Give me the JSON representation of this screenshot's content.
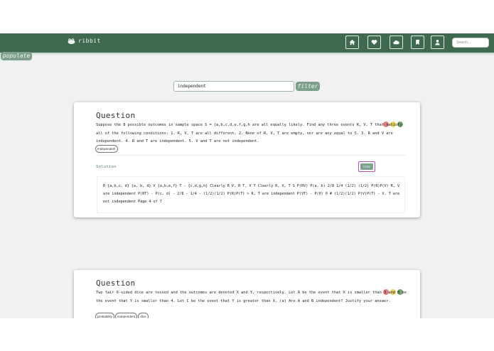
{
  "navbar": {
    "brand": "ribbit",
    "icons": [
      "home-icon",
      "heart-icon",
      "cloud-icon",
      "bookmark-icon",
      "user-icon"
    ],
    "search_placeholder": "Search...",
    "colors": {
      "bar": "#3f6a4f",
      "accent": "#7ca08a"
    }
  },
  "populate_label": "populate",
  "filter": {
    "value": "independent",
    "button_label": "filter"
  },
  "difficulty_colors": [
    "#e07c7c",
    "#e9d25a",
    "#6ea86b"
  ],
  "cards": [
    {
      "title": "Question",
      "text": "Suppose the 8 possible outcomes in sample space S = {a,b,c,d,e,f,g,h are all equally likely. Find any three events R, V, T that satisfy all of the following conditions: 1. R, V, T are all different. 2. None of R, V, T are empty, nor are any equal to S. 3. R and V are independent. 4. R and T are independent. 5. V and T are not independent.",
      "tags": [
        "Independent"
      ],
      "solution_label": "Solution",
      "hide_label": "hide",
      "solution": "R {a,b,c, d} {a, b, d} V {a,b,e,f} T - {c,d,g,h} Clearly R V, R T, V T Clearly R, V, T S P(RV) P(a, b) 2/8 1/4 (1/2) (1/2) P(R)P(V) R, V are independent P(RT) - P(c, d) - 2/8 - 1/4 - (1/2)(1/2) P(R)P(T) > R, T are independent P(VT) - P(0) 0 # (1/2)(1/2) P(V)P(T) - V, T are not independent Page 4 of 7"
    },
    {
      "title": "Question",
      "text": "Two fair 6-sided dice are tossed and the outcomes are denoted X and Y, respectively. Let A be the event that X is smaller than 3 and B be the event that Y is smaller than 4. Let C be the event that Y is greater than X. (a) Are A and B independent? Justify your answer.",
      "tags": [
        "probability",
        "independent",
        "dice"
      ]
    }
  ]
}
